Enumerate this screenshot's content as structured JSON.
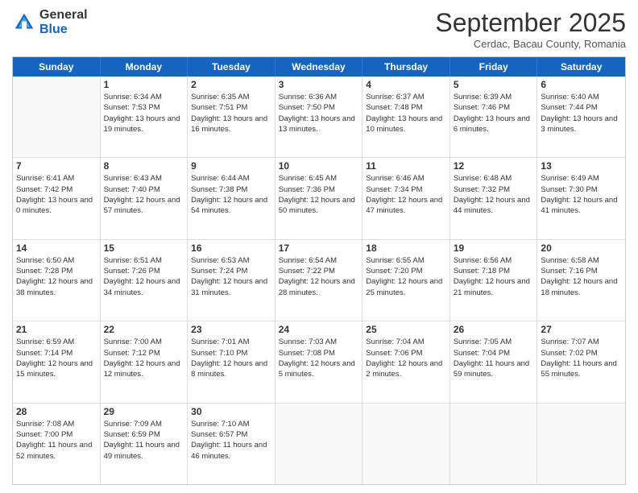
{
  "logo": {
    "general": "General",
    "blue": "Blue"
  },
  "title": "September 2025",
  "subtitle": "Cerdac, Bacau County, Romania",
  "days": [
    "Sunday",
    "Monday",
    "Tuesday",
    "Wednesday",
    "Thursday",
    "Friday",
    "Saturday"
  ],
  "weeks": [
    [
      {
        "day": "",
        "sunrise": "",
        "sunset": "",
        "daylight": ""
      },
      {
        "day": "1",
        "sunrise": "Sunrise: 6:34 AM",
        "sunset": "Sunset: 7:53 PM",
        "daylight": "Daylight: 13 hours and 19 minutes."
      },
      {
        "day": "2",
        "sunrise": "Sunrise: 6:35 AM",
        "sunset": "Sunset: 7:51 PM",
        "daylight": "Daylight: 13 hours and 16 minutes."
      },
      {
        "day": "3",
        "sunrise": "Sunrise: 6:36 AM",
        "sunset": "Sunset: 7:50 PM",
        "daylight": "Daylight: 13 hours and 13 minutes."
      },
      {
        "day": "4",
        "sunrise": "Sunrise: 6:37 AM",
        "sunset": "Sunset: 7:48 PM",
        "daylight": "Daylight: 13 hours and 10 minutes."
      },
      {
        "day": "5",
        "sunrise": "Sunrise: 6:39 AM",
        "sunset": "Sunset: 7:46 PM",
        "daylight": "Daylight: 13 hours and 6 minutes."
      },
      {
        "day": "6",
        "sunrise": "Sunrise: 6:40 AM",
        "sunset": "Sunset: 7:44 PM",
        "daylight": "Daylight: 13 hours and 3 minutes."
      }
    ],
    [
      {
        "day": "7",
        "sunrise": "Sunrise: 6:41 AM",
        "sunset": "Sunset: 7:42 PM",
        "daylight": "Daylight: 13 hours and 0 minutes."
      },
      {
        "day": "8",
        "sunrise": "Sunrise: 6:43 AM",
        "sunset": "Sunset: 7:40 PM",
        "daylight": "Daylight: 12 hours and 57 minutes."
      },
      {
        "day": "9",
        "sunrise": "Sunrise: 6:44 AM",
        "sunset": "Sunset: 7:38 PM",
        "daylight": "Daylight: 12 hours and 54 minutes."
      },
      {
        "day": "10",
        "sunrise": "Sunrise: 6:45 AM",
        "sunset": "Sunset: 7:36 PM",
        "daylight": "Daylight: 12 hours and 50 minutes."
      },
      {
        "day": "11",
        "sunrise": "Sunrise: 6:46 AM",
        "sunset": "Sunset: 7:34 PM",
        "daylight": "Daylight: 12 hours and 47 minutes."
      },
      {
        "day": "12",
        "sunrise": "Sunrise: 6:48 AM",
        "sunset": "Sunset: 7:32 PM",
        "daylight": "Daylight: 12 hours and 44 minutes."
      },
      {
        "day": "13",
        "sunrise": "Sunrise: 6:49 AM",
        "sunset": "Sunset: 7:30 PM",
        "daylight": "Daylight: 12 hours and 41 minutes."
      }
    ],
    [
      {
        "day": "14",
        "sunrise": "Sunrise: 6:50 AM",
        "sunset": "Sunset: 7:28 PM",
        "daylight": "Daylight: 12 hours and 38 minutes."
      },
      {
        "day": "15",
        "sunrise": "Sunrise: 6:51 AM",
        "sunset": "Sunset: 7:26 PM",
        "daylight": "Daylight: 12 hours and 34 minutes."
      },
      {
        "day": "16",
        "sunrise": "Sunrise: 6:53 AM",
        "sunset": "Sunset: 7:24 PM",
        "daylight": "Daylight: 12 hours and 31 minutes."
      },
      {
        "day": "17",
        "sunrise": "Sunrise: 6:54 AM",
        "sunset": "Sunset: 7:22 PM",
        "daylight": "Daylight: 12 hours and 28 minutes."
      },
      {
        "day": "18",
        "sunrise": "Sunrise: 6:55 AM",
        "sunset": "Sunset: 7:20 PM",
        "daylight": "Daylight: 12 hours and 25 minutes."
      },
      {
        "day": "19",
        "sunrise": "Sunrise: 6:56 AM",
        "sunset": "Sunset: 7:18 PM",
        "daylight": "Daylight: 12 hours and 21 minutes."
      },
      {
        "day": "20",
        "sunrise": "Sunrise: 6:58 AM",
        "sunset": "Sunset: 7:16 PM",
        "daylight": "Daylight: 12 hours and 18 minutes."
      }
    ],
    [
      {
        "day": "21",
        "sunrise": "Sunrise: 6:59 AM",
        "sunset": "Sunset: 7:14 PM",
        "daylight": "Daylight: 12 hours and 15 minutes."
      },
      {
        "day": "22",
        "sunrise": "Sunrise: 7:00 AM",
        "sunset": "Sunset: 7:12 PM",
        "daylight": "Daylight: 12 hours and 12 minutes."
      },
      {
        "day": "23",
        "sunrise": "Sunrise: 7:01 AM",
        "sunset": "Sunset: 7:10 PM",
        "daylight": "Daylight: 12 hours and 8 minutes."
      },
      {
        "day": "24",
        "sunrise": "Sunrise: 7:03 AM",
        "sunset": "Sunset: 7:08 PM",
        "daylight": "Daylight: 12 hours and 5 minutes."
      },
      {
        "day": "25",
        "sunrise": "Sunrise: 7:04 AM",
        "sunset": "Sunset: 7:06 PM",
        "daylight": "Daylight: 12 hours and 2 minutes."
      },
      {
        "day": "26",
        "sunrise": "Sunrise: 7:05 AM",
        "sunset": "Sunset: 7:04 PM",
        "daylight": "Daylight: 11 hours and 59 minutes."
      },
      {
        "day": "27",
        "sunrise": "Sunrise: 7:07 AM",
        "sunset": "Sunset: 7:02 PM",
        "daylight": "Daylight: 11 hours and 55 minutes."
      }
    ],
    [
      {
        "day": "28",
        "sunrise": "Sunrise: 7:08 AM",
        "sunset": "Sunset: 7:00 PM",
        "daylight": "Daylight: 11 hours and 52 minutes."
      },
      {
        "day": "29",
        "sunrise": "Sunrise: 7:09 AM",
        "sunset": "Sunset: 6:59 PM",
        "daylight": "Daylight: 11 hours and 49 minutes."
      },
      {
        "day": "30",
        "sunrise": "Sunrise: 7:10 AM",
        "sunset": "Sunset: 6:57 PM",
        "daylight": "Daylight: 11 hours and 46 minutes."
      },
      {
        "day": "",
        "sunrise": "",
        "sunset": "",
        "daylight": ""
      },
      {
        "day": "",
        "sunrise": "",
        "sunset": "",
        "daylight": ""
      },
      {
        "day": "",
        "sunrise": "",
        "sunset": "",
        "daylight": ""
      },
      {
        "day": "",
        "sunrise": "",
        "sunset": "",
        "daylight": ""
      }
    ]
  ]
}
